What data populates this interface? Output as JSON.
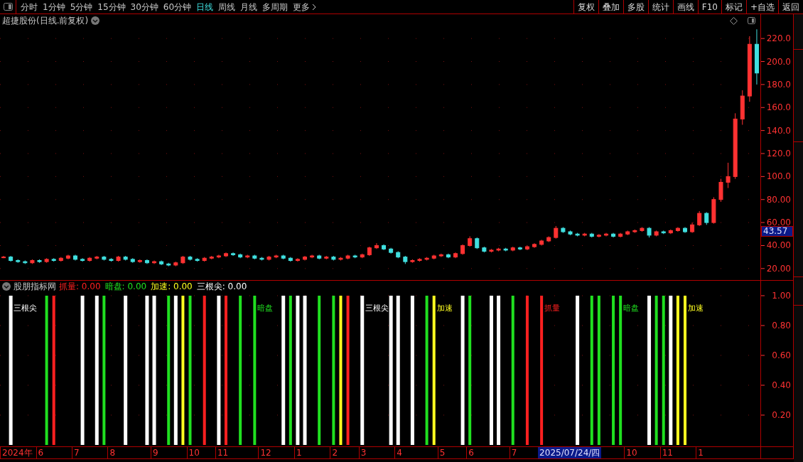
{
  "toolbar": {
    "periods": [
      {
        "label": "分时",
        "selected": false
      },
      {
        "label": "1分钟",
        "selected": false
      },
      {
        "label": "5分钟",
        "selected": false
      },
      {
        "label": "15分钟",
        "selected": false
      },
      {
        "label": "30分钟",
        "selected": false
      },
      {
        "label": "60分钟",
        "selected": false
      },
      {
        "label": "日线",
        "selected": true
      },
      {
        "label": "周线",
        "selected": false
      },
      {
        "label": "月线",
        "selected": false
      },
      {
        "label": "多周期",
        "selected": false
      },
      {
        "label": "更多",
        "selected": false
      }
    ],
    "buttons": [
      "复权",
      "叠加",
      "多股",
      "统计",
      "画线",
      "F10",
      "标记",
      "+自选",
      "返回"
    ]
  },
  "main_chart": {
    "title": "超捷股份(日线.前复权)",
    "current_price": "43.57",
    "chart_data": {
      "type": "candlestick",
      "grid": true,
      "categories": [
        null,
        null,
        null,
        null,
        null,
        null,
        null,
        null,
        null,
        null,
        null,
        null,
        null,
        null,
        null,
        null,
        null,
        null,
        null,
        null,
        null,
        null,
        null,
        null,
        null,
        null,
        null,
        null,
        null,
        null,
        null,
        null,
        null,
        null,
        null,
        null,
        null,
        null,
        null,
        null,
        null,
        null,
        null,
        null,
        null,
        null,
        null,
        null,
        null,
        null,
        null,
        null,
        null,
        null,
        null,
        null,
        null,
        null,
        null,
        null,
        null,
        null,
        null,
        null,
        null,
        null,
        null,
        null,
        null,
        null,
        null,
        null,
        null,
        null,
        null,
        null,
        null,
        null,
        null,
        null,
        null,
        null,
        null,
        null,
        null,
        null,
        null,
        null,
        null,
        null,
        null,
        null,
        null,
        null,
        null,
        null,
        null,
        null,
        null,
        null,
        null,
        null,
        null,
        null,
        null,
        null
      ],
      "ylim": [
        10,
        230
      ],
      "yticks": [
        {
          "value": 20,
          "label": "20.00"
        },
        {
          "value": 40,
          "label": "40.00"
        },
        {
          "value": 60,
          "label": "60.00"
        },
        {
          "value": 80,
          "label": "80.00"
        },
        {
          "value": 100,
          "label": "100.0"
        },
        {
          "value": 120,
          "label": "120.0"
        },
        {
          "value": 140,
          "label": "140.0"
        },
        {
          "value": 160,
          "label": "160.0"
        },
        {
          "value": 180,
          "label": "180.0"
        },
        {
          "value": 200,
          "label": "200.0"
        },
        {
          "value": 220,
          "label": "220.0"
        }
      ],
      "ohlc": [
        [
          30,
          31,
          29,
          30
        ],
        [
          30,
          31,
          26,
          27
        ],
        [
          27,
          28,
          25,
          26
        ],
        [
          26,
          27,
          24,
          25
        ],
        [
          25,
          28,
          24,
          27
        ],
        [
          27,
          28,
          25,
          26
        ],
        [
          26,
          29,
          25,
          28
        ],
        [
          28,
          29,
          26,
          27
        ],
        [
          27,
          30,
          26,
          29
        ],
        [
          29,
          32,
          28,
          31
        ],
        [
          31,
          32,
          27,
          28
        ],
        [
          28,
          29,
          26,
          27
        ],
        [
          27,
          30,
          26,
          29
        ],
        [
          29,
          31,
          28,
          30
        ],
        [
          30,
          31,
          27,
          28
        ],
        [
          28,
          29,
          26,
          27
        ],
        [
          27,
          31,
          26,
          30
        ],
        [
          30,
          31,
          27,
          28
        ],
        [
          28,
          29,
          25,
          26
        ],
        [
          26,
          28,
          25,
          27
        ],
        [
          27,
          28,
          24,
          25
        ],
        [
          25,
          27,
          24,
          26
        ],
        [
          26,
          27,
          23,
          24
        ],
        [
          24,
          25,
          22,
          23
        ],
        [
          23,
          26,
          22,
          25
        ],
        [
          25,
          31,
          24,
          30
        ],
        [
          30,
          31,
          27,
          28
        ],
        [
          28,
          29,
          26,
          27
        ],
        [
          27,
          30,
          26,
          29
        ],
        [
          29,
          31,
          28,
          30
        ],
        [
          30,
          32,
          29,
          31
        ],
        [
          31,
          34,
          30,
          33
        ],
        [
          33,
          34,
          31,
          32
        ],
        [
          32,
          33,
          29,
          30
        ],
        [
          30,
          32,
          29,
          31
        ],
        [
          31,
          32,
          28,
          29
        ],
        [
          29,
          30,
          27,
          28
        ],
        [
          28,
          31,
          27,
          30
        ],
        [
          30,
          32,
          29,
          31
        ],
        [
          31,
          32,
          28,
          29
        ],
        [
          29,
          30,
          26,
          27
        ],
        [
          27,
          29,
          26,
          28
        ],
        [
          28,
          31,
          27,
          30
        ],
        [
          30,
          32,
          29,
          31
        ],
        [
          31,
          32,
          28,
          29
        ],
        [
          29,
          31,
          28,
          30
        ],
        [
          30,
          31,
          27,
          28
        ],
        [
          28,
          30,
          27,
          29
        ],
        [
          29,
          32,
          28,
          31
        ],
        [
          31,
          32,
          29,
          30
        ],
        [
          30,
          33,
          29,
          32
        ],
        [
          32,
          39,
          31,
          38
        ],
        [
          38,
          42,
          37,
          40
        ],
        [
          40,
          41,
          36,
          37
        ],
        [
          37,
          38,
          33,
          34
        ],
        [
          34,
          35,
          29,
          30
        ],
        [
          30,
          31,
          24,
          26
        ],
        [
          26,
          28,
          25,
          27
        ],
        [
          27,
          29,
          26,
          28
        ],
        [
          28,
          30,
          27,
          29
        ],
        [
          29,
          32,
          28,
          31
        ],
        [
          31,
          33,
          30,
          32
        ],
        [
          32,
          33,
          29,
          30
        ],
        [
          30,
          34,
          29,
          33
        ],
        [
          33,
          41,
          32,
          40
        ],
        [
          40,
          48,
          39,
          46
        ],
        [
          46,
          47,
          37,
          38
        ],
        [
          38,
          39,
          34,
          35
        ],
        [
          35,
          37,
          34,
          36
        ],
        [
          36,
          38,
          35,
          37
        ],
        [
          37,
          38,
          35,
          36
        ],
        [
          36,
          39,
          35,
          38
        ],
        [
          38,
          39,
          36,
          37
        ],
        [
          37,
          40,
          36,
          39
        ],
        [
          39,
          42,
          38,
          41
        ],
        [
          41,
          45,
          40,
          44
        ],
        [
          44,
          48,
          43,
          47
        ],
        [
          47,
          57,
          46,
          55
        ],
        [
          55,
          56,
          51,
          52
        ],
        [
          52,
          53,
          49,
          50
        ],
        [
          50,
          51,
          48,
          49
        ],
        [
          49,
          51,
          48,
          50
        ],
        [
          50,
          51,
          47,
          48
        ],
        [
          48,
          50,
          47,
          49
        ],
        [
          49,
          51,
          48,
          50
        ],
        [
          50,
          51,
          47,
          48
        ],
        [
          48,
          51,
          47,
          50
        ],
        [
          50,
          53,
          49,
          52
        ],
        [
          52,
          54,
          51,
          53
        ],
        [
          53,
          56,
          52,
          55
        ],
        [
          55,
          56,
          47,
          49
        ],
        [
          49,
          53,
          48,
          52
        ],
        [
          52,
          53,
          50,
          51
        ],
        [
          51,
          54,
          50,
          53
        ],
        [
          53,
          56,
          52,
          55
        ],
        [
          55,
          56,
          51,
          52
        ],
        [
          52,
          60,
          51,
          58
        ],
        [
          58,
          70,
          57,
          68
        ],
        [
          68,
          69,
          58,
          60
        ],
        [
          60,
          82,
          59,
          80
        ],
        [
          80,
          98,
          78,
          95
        ],
        [
          95,
          112,
          90,
          100
        ],
        [
          100,
          155,
          98,
          150
        ],
        [
          150,
          175,
          145,
          170
        ],
        [
          170,
          222,
          165,
          215
        ],
        [
          215,
          228,
          180,
          190
        ]
      ]
    }
  },
  "indicator": {
    "name": "股朋指标网",
    "legend": [
      {
        "label": "抓量:",
        "value": "0.00"
      },
      {
        "label": "暗盘:",
        "value": "0.00"
      },
      {
        "label": "加速:",
        "value": "0.00"
      },
      {
        "label": "三根尖:",
        "value": "0.00"
      }
    ],
    "signal_labels": [
      {
        "kind": "sanjian",
        "text": "三根尖"
      },
      {
        "kind": "anpan",
        "text": "暗盘"
      },
      {
        "kind": "sanjian",
        "text": "三根尖"
      },
      {
        "kind": "jiasu",
        "text": "加速"
      },
      {
        "kind": "zhualiang",
        "text": "抓量"
      },
      {
        "kind": "anpan",
        "text": "暗盘"
      },
      {
        "kind": "jiasu",
        "text": "加速"
      }
    ],
    "time_axis": [
      "2024年",
      "6",
      "7",
      "8",
      "9",
      "10",
      "11",
      "12",
      "1",
      "2",
      "3",
      "4",
      "5",
      "6",
      "7",
      "10",
      "11",
      "1"
    ],
    "cursor_date": "2025/07/24/四",
    "chart_data": {
      "type": "bar",
      "grid": true,
      "ylim": [
        0,
        1
      ],
      "yticks": [
        {
          "value": 1,
          "label": "1.00"
        },
        {
          "value": 0.8,
          "label": "0.80"
        },
        {
          "value": 0.6,
          "label": "0.60"
        },
        {
          "value": 0.4,
          "label": "0.40"
        },
        {
          "value": 0.2,
          "label": "0.20"
        }
      ],
      "series": [
        {
          "color": "#ff2020",
          "values": [
            0,
            0,
            0,
            0,
            0,
            0,
            0,
            1,
            0,
            0,
            0,
            0,
            0,
            0,
            0,
            0,
            0,
            0,
            0,
            0,
            0,
            0,
            0,
            0,
            0,
            0,
            0,
            0,
            1,
            0,
            0,
            1,
            0,
            0,
            0,
            0,
            0,
            0,
            0,
            0,
            0,
            0,
            0,
            0,
            0,
            0,
            0,
            0,
            1,
            0,
            0,
            0,
            0,
            0,
            0,
            0,
            0,
            0,
            0,
            0,
            0,
            0,
            0,
            0,
            0,
            0,
            0,
            0,
            0,
            0,
            0,
            0,
            0,
            1,
            0,
            1,
            0,
            0,
            0,
            0,
            0,
            0,
            0,
            0,
            0,
            0,
            0,
            0,
            0,
            0,
            0,
            0,
            0,
            0,
            0,
            0,
            0,
            0,
            0,
            0,
            0,
            0,
            0,
            0,
            0,
            0
          ]
        },
        {
          "color": "#20e020",
          "values": [
            0,
            0,
            0,
            0,
            0,
            0,
            1,
            0,
            0,
            0,
            0,
            0,
            0,
            0,
            1,
            0,
            0,
            0,
            0,
            0,
            0,
            0,
            0,
            1,
            0,
            0,
            1,
            0,
            0,
            0,
            0,
            0,
            0,
            1,
            0,
            1,
            0,
            0,
            0,
            0,
            1,
            0,
            0,
            0,
            1,
            0,
            1,
            0,
            0,
            0,
            0,
            0,
            0,
            0,
            0,
            0,
            0,
            0,
            0,
            1,
            0,
            0,
            0,
            0,
            0,
            1,
            0,
            0,
            0,
            0,
            0,
            1,
            0,
            0,
            0,
            0,
            0,
            0,
            0,
            0,
            0,
            0,
            1,
            1,
            0,
            1,
            1,
            0,
            0,
            0,
            0,
            1,
            1,
            0,
            0,
            0,
            0,
            0,
            0,
            0,
            0,
            0,
            0,
            0,
            0,
            0
          ]
        },
        {
          "color": "#ffff20",
          "values": [
            0,
            0,
            0,
            0,
            0,
            0,
            0,
            0,
            0,
            0,
            0,
            0,
            0,
            0,
            0,
            0,
            0,
            0,
            0,
            0,
            0,
            0,
            0,
            0,
            0,
            1,
            0,
            0,
            0,
            0,
            0,
            0,
            0,
            0,
            0,
            0,
            0,
            0,
            0,
            0,
            0,
            0,
            0,
            0,
            0,
            0,
            0,
            1,
            0,
            0,
            0,
            0,
            0,
            0,
            0,
            0,
            0,
            0,
            0,
            0,
            1,
            0,
            0,
            0,
            0,
            0,
            0,
            0,
            0,
            0,
            0,
            0,
            0,
            0,
            0,
            0,
            0,
            0,
            0,
            0,
            0,
            0,
            0,
            0,
            0,
            0,
            0,
            0,
            0,
            0,
            0,
            0,
            0,
            0,
            1,
            1,
            0,
            0,
            0,
            0,
            0,
            0,
            0,
            0,
            0,
            0
          ]
        },
        {
          "color": "#ffffff",
          "values": [
            0,
            1,
            0,
            0,
            0,
            0,
            0,
            0,
            0,
            0,
            0,
            1,
            0,
            1,
            0,
            0,
            0,
            1,
            0,
            0,
            1,
            1,
            0,
            0,
            1,
            0,
            0,
            0,
            0,
            0,
            1,
            0,
            0,
            0,
            0,
            0,
            0,
            0,
            0,
            1,
            0,
            1,
            1,
            0,
            0,
            0,
            0,
            0,
            0,
            0,
            1,
            0,
            0,
            0,
            1,
            1,
            0,
            1,
            0,
            0,
            0,
            0,
            0,
            0,
            1,
            0,
            0,
            0,
            1,
            1,
            0,
            0,
            0,
            0,
            0,
            0,
            0,
            0,
            0,
            0,
            1,
            0,
            0,
            0,
            0,
            0,
            0,
            0,
            0,
            0,
            1,
            0,
            0,
            1,
            0,
            0,
            0,
            0,
            0,
            0,
            0,
            0,
            0,
            0,
            0,
            0
          ]
        }
      ]
    }
  }
}
